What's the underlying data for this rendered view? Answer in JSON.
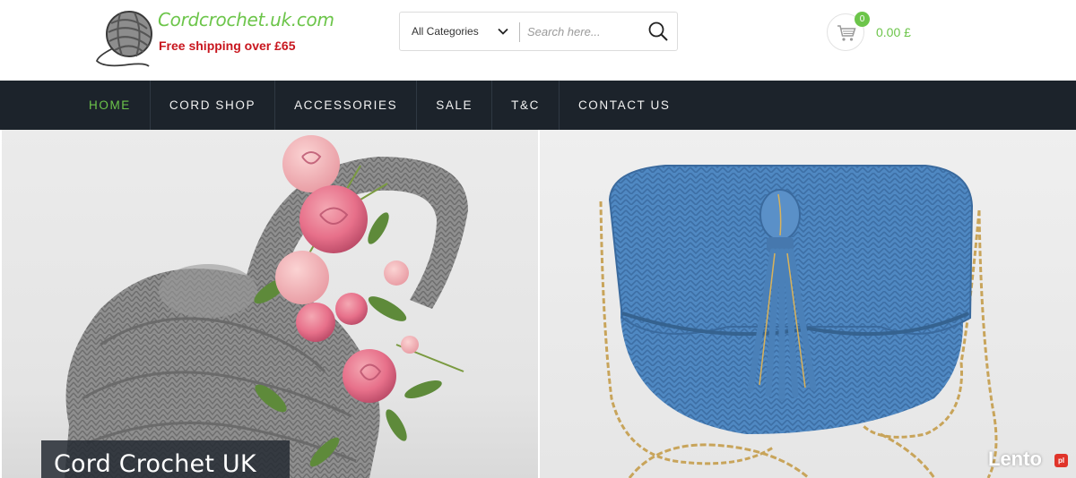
{
  "header": {
    "brand_title": "Cordcrochet.uk.com",
    "brand_subtitle": "Free shipping over £65",
    "logo_icon": "yarn-ball-icon",
    "search": {
      "category_label": "All Categories",
      "placeholder": "Search here...",
      "value": ""
    },
    "cart": {
      "count": "0",
      "total": "0.00 £",
      "icon": "shopping-cart-icon"
    }
  },
  "nav": {
    "items": [
      {
        "label": "HOME",
        "active": true
      },
      {
        "label": "CORD SHOP"
      },
      {
        "label": "ACCESSORIES"
      },
      {
        "label": "SALE"
      },
      {
        "label": "T&C"
      },
      {
        "label": "CONTACT US"
      }
    ]
  },
  "hero": {
    "caption": "Cord Crochet UK",
    "watermark": "Lento",
    "watermark_badge": "pl"
  },
  "colors": {
    "accent_green": "#6cc54a",
    "brand_red": "#c8161e",
    "nav_bg": "#1c232b",
    "bag_blue": "#4a82bd",
    "bag_grey": "#8a8a8a"
  }
}
